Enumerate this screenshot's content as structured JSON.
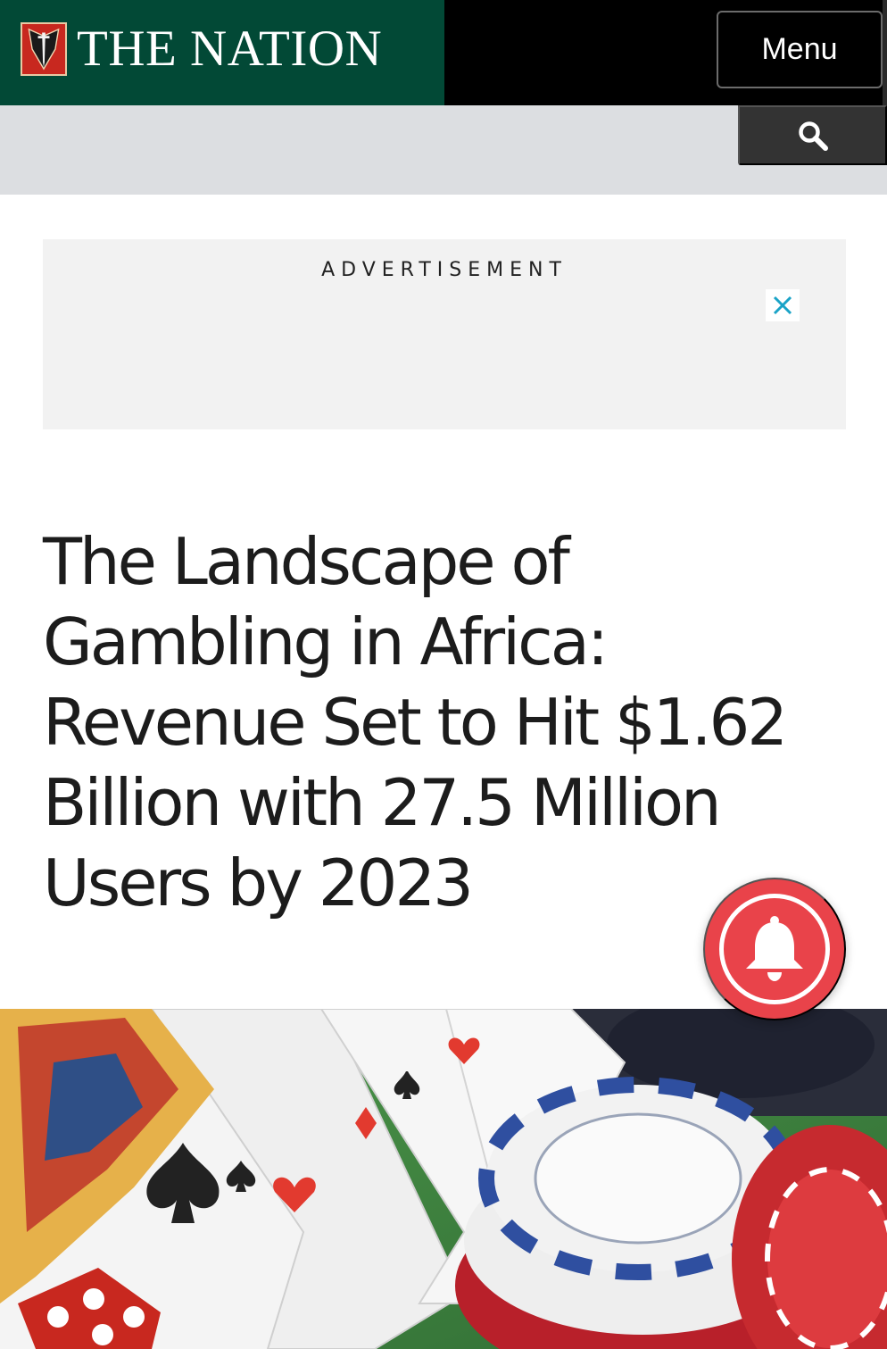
{
  "header": {
    "brand_name": "THE NATION",
    "menu_label": "Menu",
    "brand_color": "#024936",
    "logo_icon": "dagger-shield-icon"
  },
  "search": {
    "icon": "search-icon"
  },
  "advertisement": {
    "label": "ADVERTISEMENT",
    "close_icon": "close-icon",
    "close_color": "#1aa3c7"
  },
  "article": {
    "headline": "The Landscape of Gambling in Africa: Revenue Set to Hit $1.62 Billion with 27.5 Million Users by 2023",
    "hero_image": "playing-cards-casino-chips-dice"
  },
  "notification": {
    "icon": "bell-icon",
    "color": "#e9434a"
  }
}
